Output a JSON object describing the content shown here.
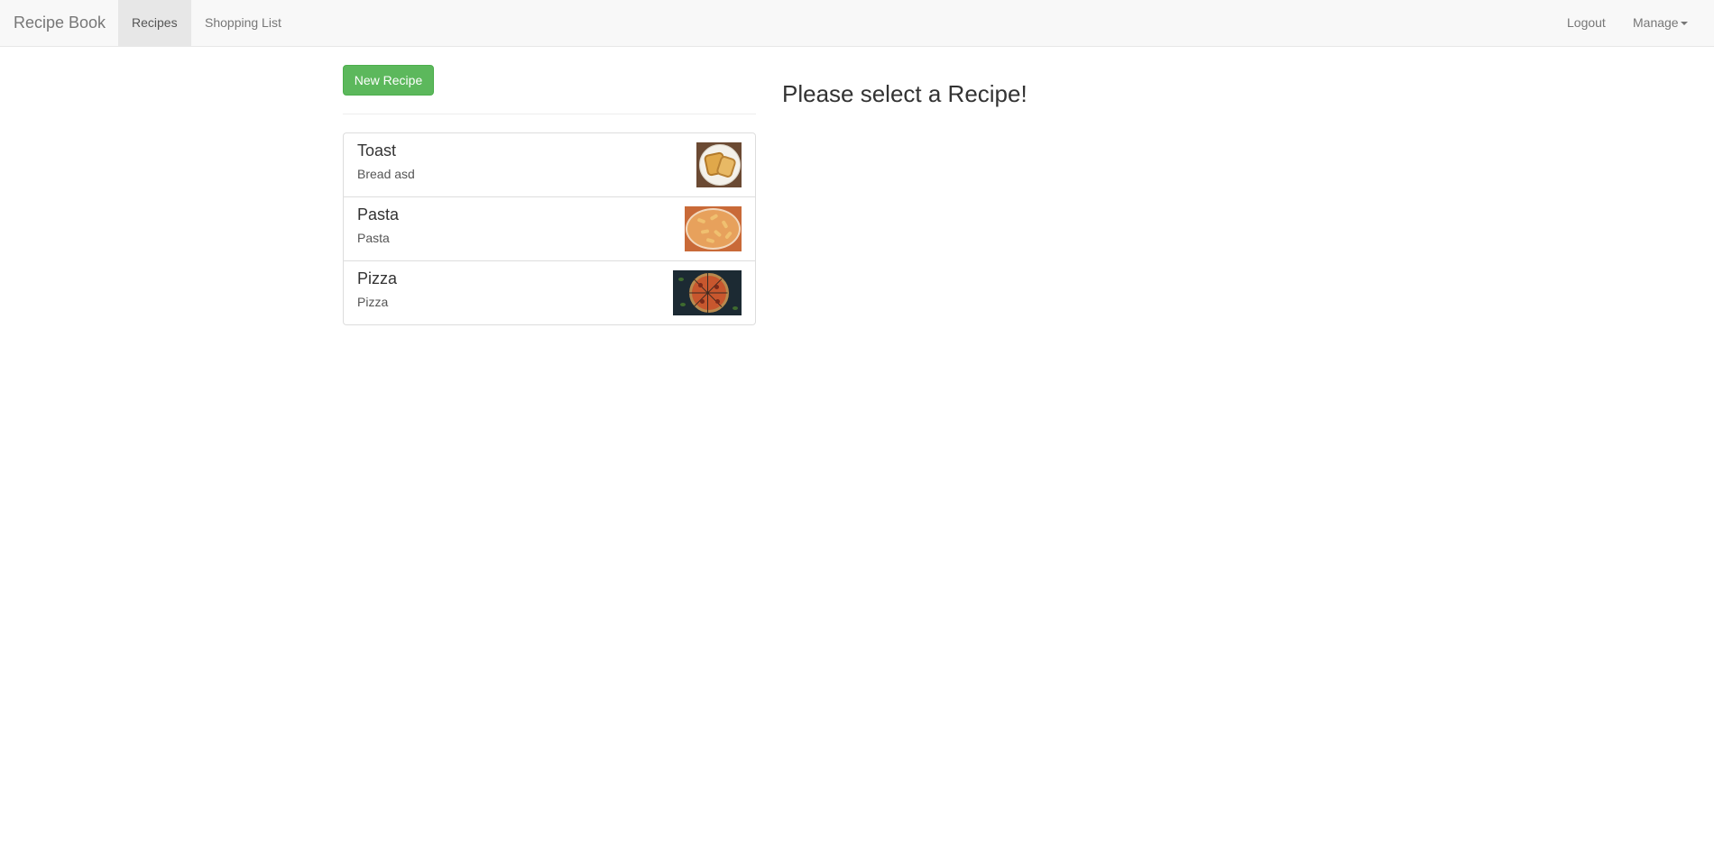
{
  "navbar": {
    "brand": "Recipe Book",
    "links": {
      "recipes": "Recipes",
      "shopping_list": "Shopping List",
      "logout": "Logout",
      "manage": "Manage"
    }
  },
  "sidebar": {
    "new_recipe_label": "New Recipe",
    "recipes": [
      {
        "name": "Toast",
        "description": "Bread asd",
        "image": "toast-photo"
      },
      {
        "name": "Pasta",
        "description": "Pasta",
        "image": "pasta-photo"
      },
      {
        "name": "Pizza",
        "description": "Pizza",
        "image": "pizza-photo"
      }
    ]
  },
  "main": {
    "placeholder": "Please select a Recipe!"
  },
  "colors": {
    "navbar_bg": "#f8f8f8",
    "success": "#5cb85c",
    "active_nav": "#e7e7e7"
  }
}
